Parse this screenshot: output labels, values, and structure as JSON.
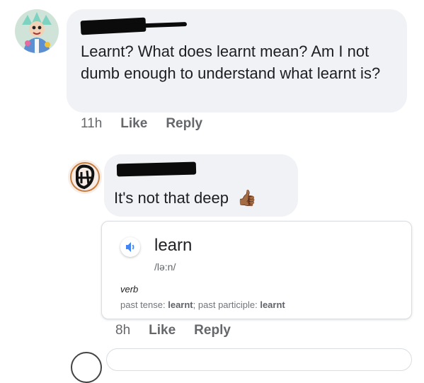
{
  "comment1": {
    "text": "Learnt? What does learnt mean? Am I not dumb enough to understand what learnt is?",
    "time": "11h",
    "like_label": "Like",
    "reply_label": "Reply"
  },
  "comment2": {
    "text": "It's not that deep",
    "emoji": "👍🏾",
    "time": "8h",
    "like_label": "Like",
    "reply_label": "Reply"
  },
  "definition": {
    "word": "learn",
    "phonetic": "/lə:n/",
    "part_of_speech": "verb",
    "past_tense_label": "past tense:",
    "past_tense": "learnt",
    "separator": ";",
    "past_participle_label": "past participle:",
    "past_participle": "learnt",
    "icon": "speaker-icon"
  },
  "colors": {
    "bubble": "#f0f2f5",
    "action_text": "#65676b",
    "speaker_blue": "#4285f4"
  }
}
